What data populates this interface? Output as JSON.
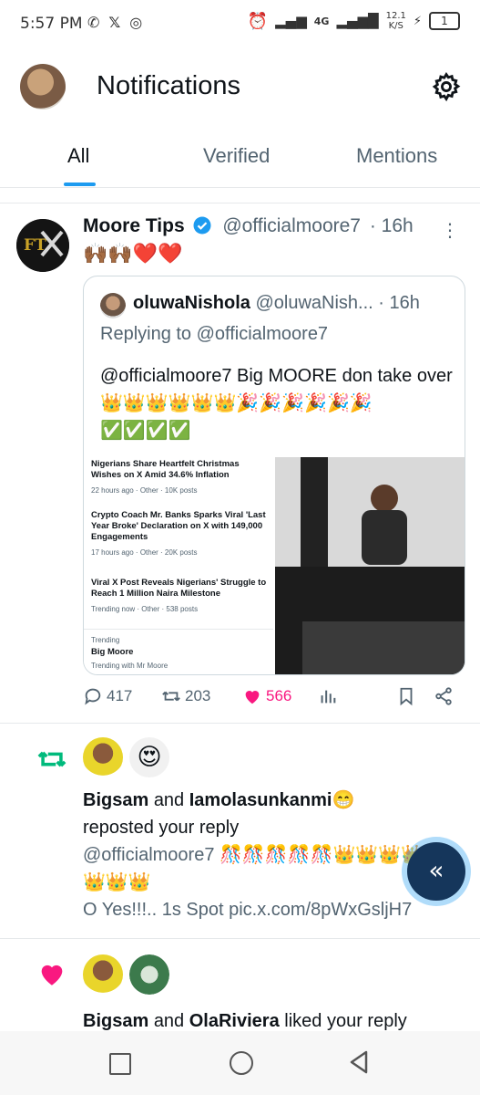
{
  "status_bar": {
    "time": "5:57 PM",
    "network": "4G",
    "speed_value": "12.1",
    "speed_unit": "K/S",
    "battery": "1"
  },
  "header": {
    "title": "Notifications"
  },
  "tabs": [
    {
      "label": "All",
      "active": true
    },
    {
      "label": "Verified",
      "active": false
    },
    {
      "label": "Mentions",
      "active": false
    }
  ],
  "tweet": {
    "author_name": "Moore Tips",
    "author_handle": "@officialmoore7",
    "time": "· 16h",
    "text": "🙌🏾🙌🏾❤️❤️",
    "quote": {
      "author_name": "oluwaNishola",
      "author_handle": "@oluwaNish...",
      "time": "· 16h",
      "replying_to": "Replying to @officialmoore7",
      "text": "@officialmoore7 Big MOORE don take over 👑👑👑👑👑👑🎉🎉🎉🎉🎉🎉✅✅✅✅",
      "news": [
        {
          "title": "Nigerians Share Heartfelt Christmas Wishes on X Amid 34.6% Inflation",
          "meta": "22 hours ago · Other · 10K posts"
        },
        {
          "title": "Crypto Coach Mr. Banks Sparks Viral 'Last Year Broke' Declaration on X with 149,000 Engagements",
          "meta": "17 hours ago · Other · 20K posts"
        },
        {
          "title": "Viral X Post Reveals Nigerians' Struggle to Reach 1 Million Naira Milestone",
          "meta": "Trending now · Other · 538 posts"
        }
      ],
      "trending_label": "Trending",
      "trending_title": "Big Moore",
      "trending_sub": "Trending with Mr Moore"
    },
    "replies": "417",
    "reposts": "203",
    "likes": "566"
  },
  "notifications": [
    {
      "type": "repost",
      "line1_user1": "Bigsam",
      "line1_and": "and",
      "line1_user2": "Iamolasunkanmi😁",
      "line2": "reposted your reply",
      "line3": "@officialmoore7 🎊🎊🎊🎊🎊👑👑👑👑",
      "line4": "👑👑👑",
      "line5": "O Yes!!!.. 1s Spot pic.x.com/8pWxGsljH7"
    },
    {
      "type": "like",
      "user1": "Bigsam",
      "and": "and",
      "user2": "OlaRiviera",
      "suffix": "liked your reply"
    }
  ],
  "colors": {
    "accent": "#1d9bf0",
    "repost_green": "#00ba7c",
    "like_pink": "#f91880",
    "text_secondary": "#536471"
  },
  "icons": {
    "settings": "gear-icon",
    "verified": "verified-badge-icon",
    "reply": "reply-icon",
    "repost": "repost-icon",
    "like": "heart-icon",
    "views": "views-icon",
    "bookmark": "bookmark-icon",
    "share": "share-icon",
    "fab": "double-chevron-left-icon"
  }
}
